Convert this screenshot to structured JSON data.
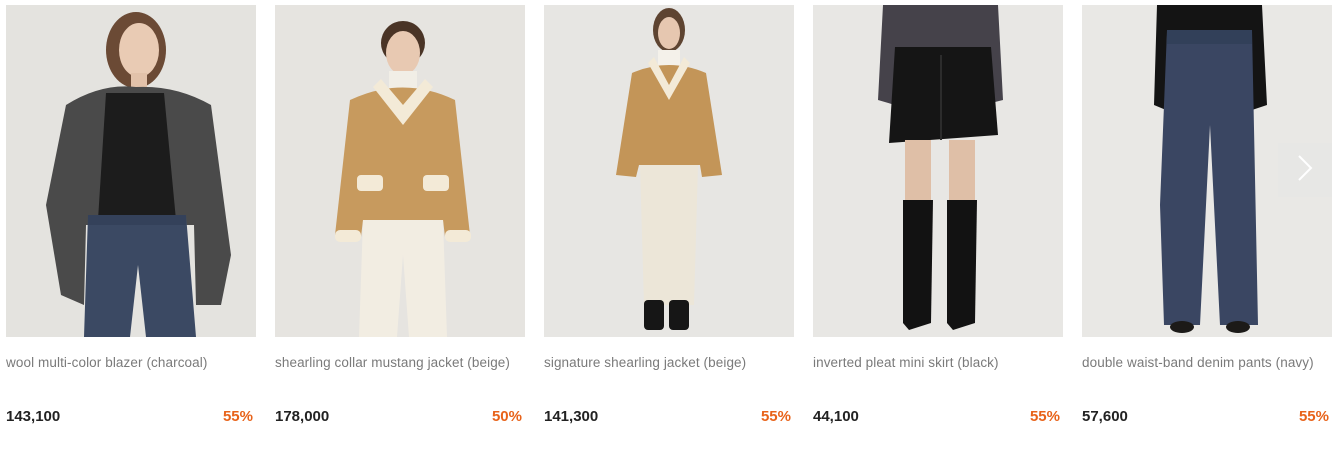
{
  "products": [
    {
      "name": "wool multi-color blazer (charcoal)",
      "price": "143,100",
      "discount": "55%"
    },
    {
      "name": "shearling collar mustang jacket (beige)",
      "price": "178,000",
      "discount": "50%"
    },
    {
      "name": "signature shearling jacket (beige)",
      "price": "141,300",
      "discount": "55%"
    },
    {
      "name": "inverted pleat mini skirt (black)",
      "price": "44,100",
      "discount": "55%"
    },
    {
      "name": "double waist-band denim pants (navy)",
      "price": "57,600",
      "discount": "55%"
    }
  ],
  "colors": {
    "discount": "#e8631a",
    "price": "#222222",
    "name": "#7a7a7a"
  },
  "icons": {
    "next": "chevron-right-icon"
  }
}
